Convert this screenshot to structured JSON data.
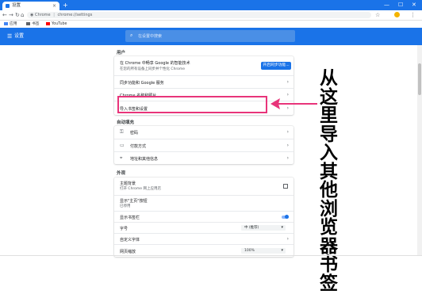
{
  "browser": {
    "tab_title": "设置",
    "tab_close": "×",
    "new_tab": "+",
    "window_controls": [
      "—",
      "☐",
      "✕"
    ],
    "nav_buttons": [
      "←",
      "→",
      "↻",
      "⌂"
    ],
    "omnibox_scheme": "Chrome",
    "omnibox_separator": "|",
    "omnibox_path": "chrome://settings",
    "toolbar_right": [
      "☆",
      "⋮"
    ],
    "bookmarks": [
      {
        "label": "应用",
        "icon": "apps-icon"
      },
      {
        "label": "书签",
        "icon": "bookmark-icon"
      },
      {
        "label": "YouTube",
        "icon": "youtube-icon"
      }
    ]
  },
  "settings": {
    "menu_icon": "☰",
    "title": "设置",
    "search_placeholder": "在设置中搜索",
    "sections": {
      "people": {
        "title": "用户",
        "sync_title": "在 Chrome 中畅享 Google 的智能技术",
        "sync_subtitle": "在您的所有设备上同步并个性化 Chrome",
        "sync_button": "开启同步功能...",
        "rows": [
          "同步功能和 Google 服务",
          "Chrome 名称和照片",
          "导入书签和设置"
        ]
      },
      "autofill": {
        "title": "自动填充",
        "rows": [
          "密码",
          "付款方式",
          "地址和其他信息"
        ]
      },
      "appearance": {
        "title": "外观",
        "theme_label": "主题背景",
        "theme_sub": "打开 Chrome 网上应用店",
        "home_label": "显示\"主页\"按钮",
        "home_sub": "已停用",
        "bookmarks_bar_label": "显示书签栏",
        "font_size_label": "字号",
        "font_size_value": "中 (推荐)",
        "custom_fonts_label": "自定义字体",
        "zoom_label": "网页缩放",
        "zoom_value": "100%"
      }
    }
  },
  "annotation": {
    "text": "从这里导入其他浏览器书签",
    "color": "#e8347a"
  }
}
